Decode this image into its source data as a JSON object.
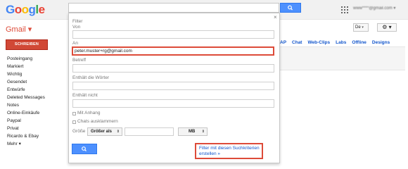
{
  "header": {
    "logo": {
      "g1": "G",
      "o1": "o",
      "o2": "o",
      "g2": "g",
      "l": "l",
      "e": "e"
    },
    "account_label": "www****@gmail.com ▾"
  },
  "sidebar": {
    "app_label": "Gmail ▾",
    "compose_label": "SCHREIBEN",
    "items": [
      "Posteingang",
      "Markiert",
      "Wichtig",
      "Gesendet",
      "Entwürfe",
      "Deleted Messages",
      "Notes",
      "Online-Einkäufe",
      "Paypal",
      "Privat",
      "Ricardo & Ebay",
      "Mehr ▾"
    ]
  },
  "toolbar": {
    "language": "De",
    "gear": "⚙ ▾"
  },
  "settings_tabs": [
    "AP",
    "Chat",
    "Web-Clips",
    "Labs",
    "Offline",
    "Designs"
  ],
  "filter": {
    "title": "Filter",
    "close": "×",
    "from_label": "Von",
    "to_label": "An",
    "to_value": "peter.muster+rg@gmail.com",
    "subject_label": "Betreff",
    "has_words_label": "Enthält die Wörter",
    "not_has_label": "Enthält nicht",
    "attachment_label": "Mit Anhang",
    "chats_label": "Chats ausklammern",
    "size_label": "Größe",
    "size_operator": "Größer als",
    "size_unit": "MB",
    "create_filter_link": "Filter mit diesen Suchkriterien erstellen »"
  },
  "colors": {
    "accent": "#4d90fe",
    "compose": "#d14836",
    "highlight": "#dd4b39",
    "link": "#1155cc"
  }
}
